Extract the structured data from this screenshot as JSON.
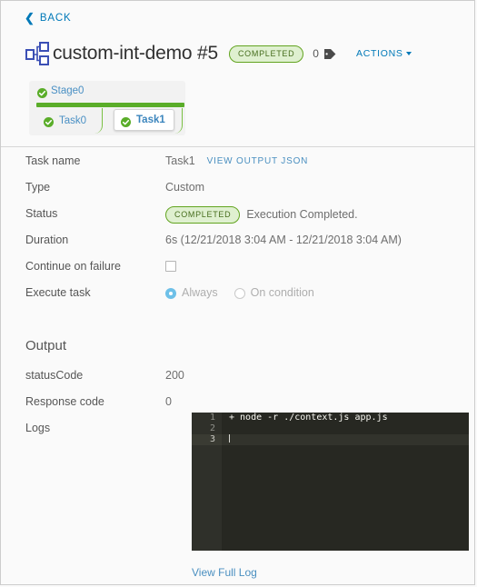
{
  "back": {
    "label": "BACK",
    "icon": "chevron-left-icon"
  },
  "header": {
    "icon": "pipeline-hierarchy-icon",
    "title": "custom-int-demo #5",
    "status_pill": "COMPLETED",
    "tag_count": "0",
    "tag_icon": "tag-icon",
    "actions_label": "ACTIONS",
    "actions_caret": "chevron-down-icon",
    "accent_color": "#0079b8",
    "pill_bg": "#dff0d0",
    "pill_border": "#62a420",
    "pill_text_color": "#466d1d"
  },
  "graph": {
    "stage": {
      "name": "Stage0",
      "status_icon": "check-circle-icon"
    },
    "progress_color": "#5aad29",
    "tasks": [
      {
        "name": "Task0",
        "status_icon": "check-circle-icon",
        "selected": false
      },
      {
        "name": "Task1",
        "status_icon": "check-circle-icon",
        "selected": true
      }
    ]
  },
  "details": {
    "task_name": {
      "label": "Task name",
      "value": "Task1",
      "link": "VIEW OUTPUT JSON"
    },
    "type": {
      "label": "Type",
      "value": "Custom"
    },
    "status": {
      "label": "Status",
      "pill": "COMPLETED",
      "message": "Execution Completed."
    },
    "duration": {
      "label": "Duration",
      "value": "6s (12/21/2018 3:04 AM - 12/21/2018 3:04 AM)"
    },
    "continue_on_failure": {
      "label": "Continue on failure",
      "checked": false
    },
    "execute_task": {
      "label": "Execute task",
      "options": [
        {
          "label": "Always",
          "selected": true
        },
        {
          "label": "On condition",
          "selected": false
        }
      ]
    }
  },
  "output": {
    "section_title": "Output",
    "status_code": {
      "label": "statusCode",
      "value": "200"
    },
    "response_code": {
      "label": "Response code",
      "value": "0"
    },
    "logs": {
      "label": "Logs",
      "lines": [
        {
          "num": "1",
          "text": "+ node -r ./context.js app.js",
          "active": false
        },
        {
          "num": "2",
          "text": "",
          "active": false
        },
        {
          "num": "3",
          "text": "",
          "active": true
        }
      ],
      "view_full_log": "View Full Log",
      "bg_color": "#272822"
    }
  }
}
